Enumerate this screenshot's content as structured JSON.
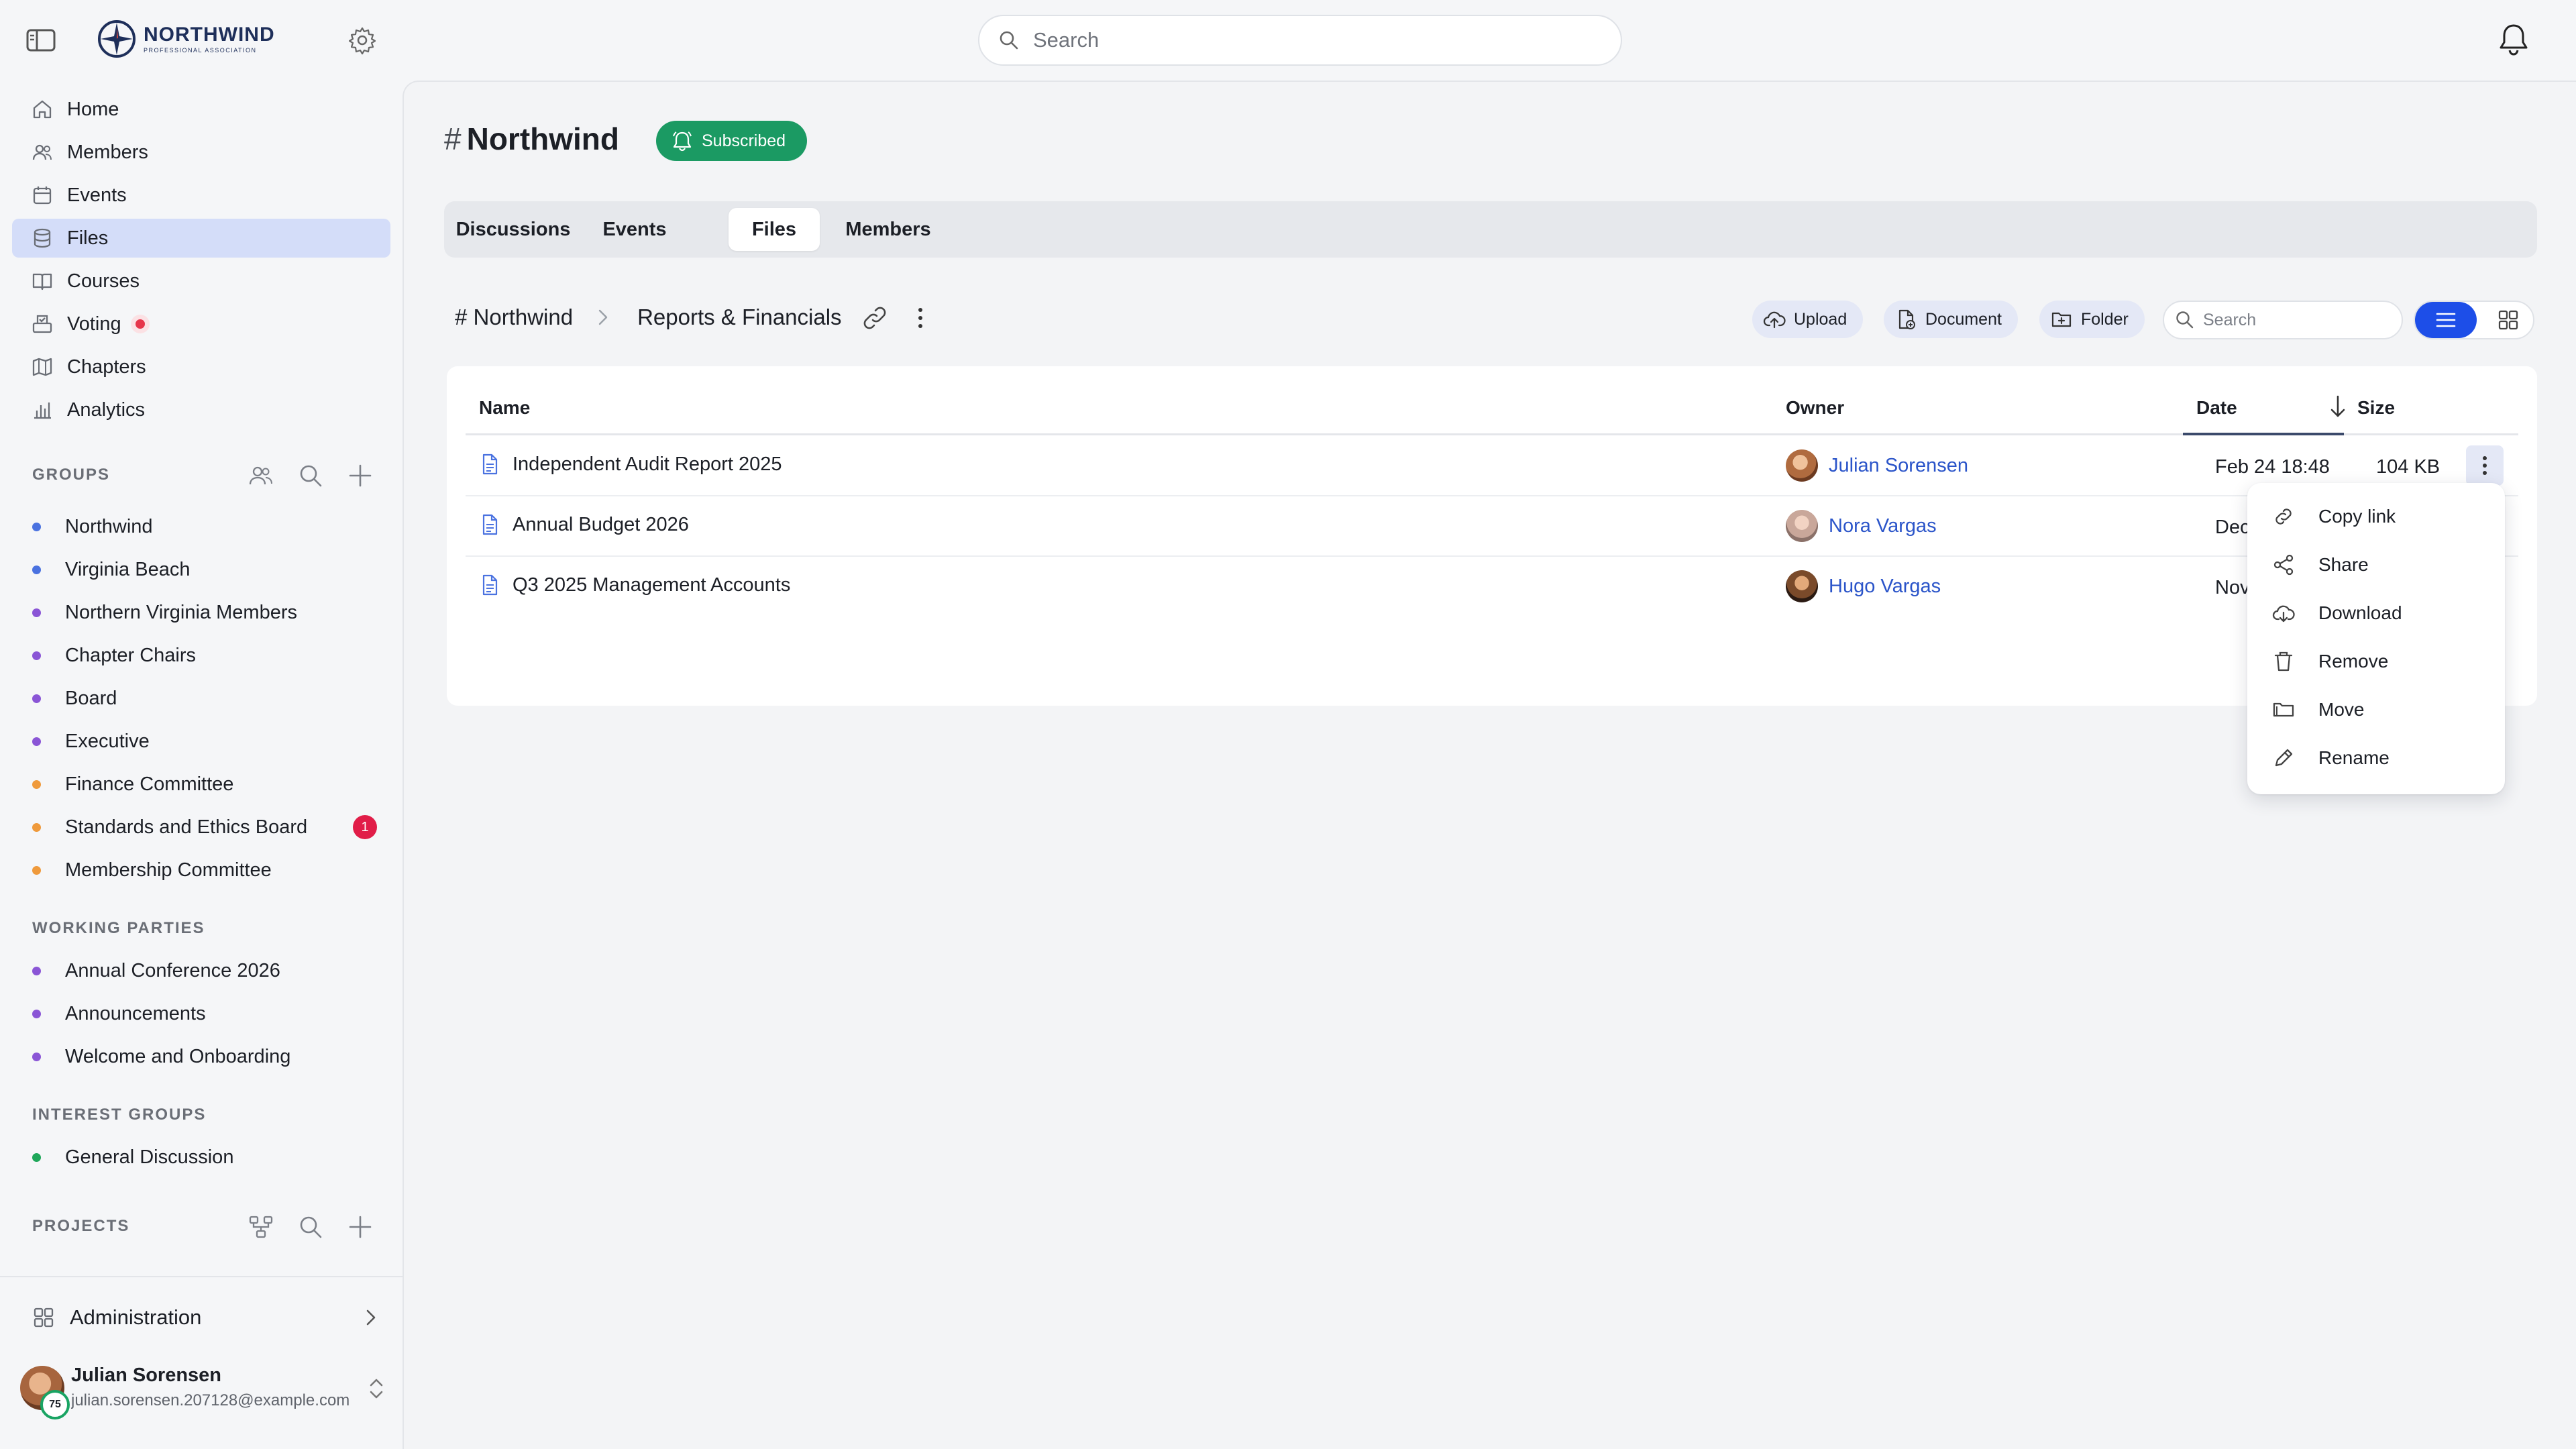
{
  "brand": {
    "name": "NORTHWIND",
    "tagline": "PROFESSIONAL ASSOCIATION"
  },
  "search": {
    "placeholder": "Search"
  },
  "nav": [
    {
      "label": "Home",
      "icon": "home-icon"
    },
    {
      "label": "Members",
      "icon": "members-icon"
    },
    {
      "label": "Events",
      "icon": "calendar-icon"
    },
    {
      "label": "Files",
      "icon": "database-icon",
      "active": true
    },
    {
      "label": "Courses",
      "icon": "book-icon"
    },
    {
      "label": "Voting",
      "icon": "ballot-icon"
    },
    {
      "label": "Chapters",
      "icon": "map-icon"
    },
    {
      "label": "Analytics",
      "icon": "chart-icon"
    }
  ],
  "groups": {
    "title": "GROUPS",
    "items": [
      {
        "label": "Northwind",
        "color": "#4a72e0"
      },
      {
        "label": "Virginia Beach",
        "color": "#4a72e0"
      },
      {
        "label": "Northern Virginia Members",
        "color": "#8a55d6"
      },
      {
        "label": "Chapter Chairs",
        "color": "#8a55d6"
      },
      {
        "label": "Board",
        "color": "#8a55d6"
      },
      {
        "label": "Executive",
        "color": "#8a55d6"
      },
      {
        "label": "Finance Committee",
        "color": "#ef9a3c"
      },
      {
        "label": "Standards and Ethics Board",
        "color": "#ef9a3c",
        "badge": "1"
      },
      {
        "label": "Membership Committee",
        "color": "#ef9a3c"
      }
    ]
  },
  "working_parties": {
    "title": "WORKING PARTIES",
    "items": [
      {
        "label": "Annual Conference 2026",
        "color": "#8a55d6"
      },
      {
        "label": "Announcements",
        "color": "#8a55d6"
      },
      {
        "label": "Welcome and Onboarding",
        "color": "#8a55d6"
      }
    ]
  },
  "interest_groups": {
    "title": "INTEREST GROUPS",
    "items": [
      {
        "label": "General Discussion",
        "color": "#1fa75a"
      }
    ]
  },
  "projects": {
    "title": "PROJECTS"
  },
  "admin": {
    "label": "Administration"
  },
  "user": {
    "name": "Julian Sorensen",
    "email": "julian.sorensen.207128@example.com",
    "level": "75"
  },
  "channel": {
    "hash": "#",
    "name": "Northwind",
    "subscribed_label": "Subscribed"
  },
  "tabs": [
    {
      "label": "Discussions"
    },
    {
      "label": "Events"
    },
    {
      "label": "Files",
      "active": true
    },
    {
      "label": "Members"
    }
  ],
  "breadcrumb": {
    "root": "# Northwind",
    "current": "Reports & Financials"
  },
  "toolbar": {
    "upload": "Upload",
    "document": "Document",
    "folder": "Folder",
    "search_placeholder": "Search"
  },
  "table": {
    "columns": {
      "name": "Name",
      "owner": "Owner",
      "date": "Date",
      "size": "Size"
    },
    "rows": [
      {
        "name": "Independent Audit Report 2025",
        "owner": "Julian Sorensen",
        "date": "Feb 24 18:48",
        "size": "104 KB"
      },
      {
        "name": "Annual Budget 2026",
        "owner": "Nora Vargas",
        "date": "Dec 15",
        "size": ""
      },
      {
        "name": "Q3 2025 Management Accounts",
        "owner": "Hugo Vargas",
        "date": "Nov 4",
        "size": ""
      }
    ]
  },
  "context_menu": [
    {
      "label": "Copy link",
      "icon": "link-icon"
    },
    {
      "label": "Share",
      "icon": "share-icon"
    },
    {
      "label": "Download",
      "icon": "cloud-download-icon"
    },
    {
      "label": "Remove",
      "icon": "trash-icon"
    },
    {
      "label": "Move",
      "icon": "folder-move-icon"
    },
    {
      "label": "Rename",
      "icon": "pencil-icon"
    }
  ],
  "colors": {
    "accent": "#1d4ee8",
    "subscribed": "#1b9a63",
    "active_nav": "#d4ddf9",
    "owner_link": "#2a54c9",
    "alert": "#e11d48"
  }
}
